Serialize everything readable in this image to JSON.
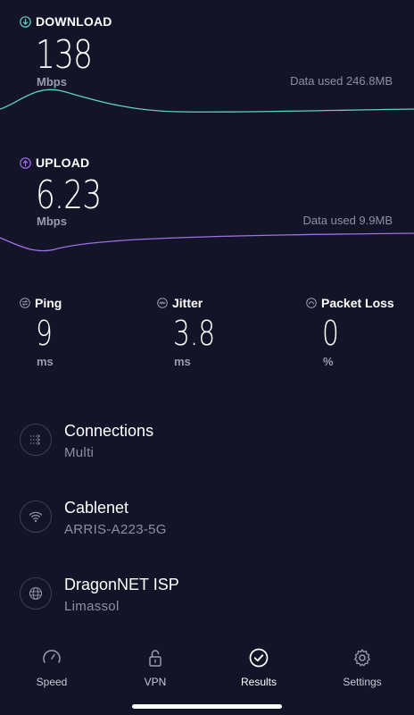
{
  "download": {
    "label": "DOWNLOAD",
    "value": "138",
    "unit": "Mbps",
    "data_used_label": "Data used",
    "data_used_value": "246.8MB",
    "color": "#5fd3c6"
  },
  "upload": {
    "label": "UPLOAD",
    "value": "6.23",
    "unit": "Mbps",
    "data_used_label": "Data used",
    "data_used_value": "9.9MB",
    "color": "#a06ee8"
  },
  "metrics": [
    {
      "label": "Ping",
      "value": "9",
      "unit": "ms",
      "icon": "ping-icon"
    },
    {
      "label": "Jitter",
      "value": "3.8",
      "unit": "ms",
      "icon": "jitter-icon"
    },
    {
      "label": "Packet Loss",
      "value": "0",
      "unit": "%",
      "icon": "packet-loss-icon"
    }
  ],
  "info": [
    {
      "title": "Connections",
      "subtitle": "Multi",
      "icon": "connections-icon"
    },
    {
      "title": "Cablenet",
      "subtitle": "ARRIS-A223-5G",
      "icon": "wifi-icon"
    },
    {
      "title": "DragonNET ISP",
      "subtitle": "Limassol",
      "icon": "globe-icon"
    }
  ],
  "tabs": [
    {
      "label": "Speed",
      "icon": "speedometer-icon"
    },
    {
      "label": "VPN",
      "icon": "lock-icon"
    },
    {
      "label": "Results",
      "icon": "check-circle-icon"
    },
    {
      "label": "Settings",
      "icon": "gear-icon"
    }
  ],
  "colors": {
    "background": "#131428",
    "muted_text": "#8d8fa2",
    "circle_border": "#3d3f58"
  }
}
